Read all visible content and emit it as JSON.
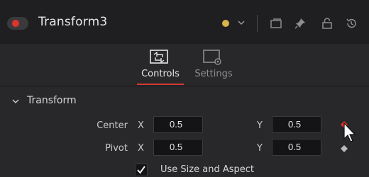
{
  "header": {
    "title": "Transform3",
    "power_icon": "power-toggle-icon",
    "color_swatch": "#d9b24b",
    "icons": [
      "chevron-down-icon",
      "window-icon",
      "pin-icon",
      "lock-icon",
      "reset-icon"
    ]
  },
  "tabs": [
    {
      "label": "Controls",
      "icon": "controls-icon",
      "active": true
    },
    {
      "label": "Settings",
      "icon": "settings-icon",
      "active": false
    }
  ],
  "section": {
    "title": "Transform",
    "expanded": true
  },
  "rows": [
    {
      "label": "Center",
      "x_label": "X",
      "x_value": "0.5",
      "y_label": "Y",
      "y_value": "0.5",
      "keyframe": "active"
    },
    {
      "label": "Pivot",
      "x_label": "X",
      "x_value": "0.5",
      "y_label": "Y",
      "y_value": "0.5",
      "keyframe": "inactive"
    }
  ],
  "checkbox": {
    "label": "Use Size and Aspect",
    "checked": true
  },
  "colors": {
    "accent": "#d23a32",
    "power": "#e0332b",
    "background": "#28282b",
    "header": "#1f1f22"
  }
}
